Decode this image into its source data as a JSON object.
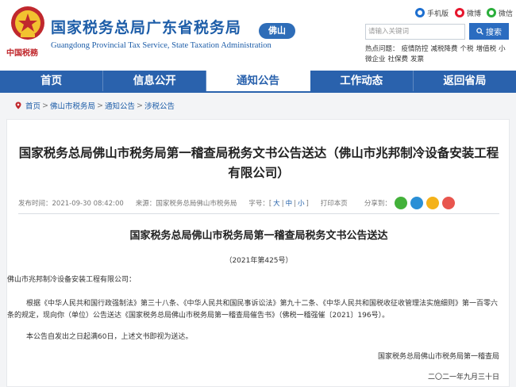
{
  "header": {
    "emblem_caption": "中国税務",
    "site_title": "国家税务总局广东省税务局",
    "site_subtitle": "Guangdong Provincial Tax Service, State Taxation Administration",
    "city_badge": "佛山",
    "social": [
      {
        "label": "手机版",
        "icon": "mobile-icon",
        "color": "#1d6fd0"
      },
      {
        "label": "微博",
        "icon": "weibo-icon",
        "color": "#e6162d"
      },
      {
        "label": "微信",
        "icon": "wechat-icon",
        "color": "#2aae3b"
      }
    ],
    "search": {
      "placeholder": "请输入关键词",
      "button": "搜索"
    },
    "hotwords_label": "热点问题：",
    "hotwords": [
      "疫情防控",
      "减税降费",
      "个税",
      "增值税",
      "小微企业",
      "社保费",
      "发票"
    ]
  },
  "nav": {
    "items": [
      "首页",
      "信息公开",
      "通知公告",
      "工作动态",
      "返回省局"
    ],
    "active_index": 2,
    "color": "#2a62ad"
  },
  "breadcrumb": {
    "items": [
      "首页",
      "佛山市税务局",
      "通知公告",
      "涉税公告"
    ],
    "separator": ">"
  },
  "article": {
    "title": "国家税务总局佛山市税务局第一稽查局税务文书公告送达（佛山市兆邦制冷设备安装工程有限公司）",
    "meta": {
      "date_label": "发布时间：",
      "date": "2021-09-30 08:42:00",
      "source_label": "来源：",
      "source": "国家税务总局佛山市税务局",
      "font_label": "字号：",
      "font_large": "大",
      "font_medium": "中",
      "font_small": "小",
      "print": "打印本页",
      "share_label": "分享到："
    },
    "share_icons": [
      "wechat-share-icon",
      "qq-share-icon",
      "qzone-share-icon",
      "weibo-share-icon"
    ],
    "doc_title": "国家税务总局佛山市税务局第一稽查局税务文书公告送达",
    "doc_no": "（2021年第425号）",
    "recipient": "佛山市兆邦制冷设备安装工程有限公司：",
    "body": "根据《中华人民共和国行政强制法》第三十八条、《中华人民共和国民事诉讼法》第九十二条、《中华人民共和国税收征收管理法实施细则》第一百零六条的规定，现向你（单位）公告送达《国家税务总局佛山市税务局第一稽查局催告书》（佛税一稽强催〔2021〕196号）。",
    "body2": "本公告自发出之日起满60日，上述文书即视为送达。",
    "signature": "国家税务总局佛山市税务局第一稽查局",
    "sign_date": "二〇二一年九月三十日"
  }
}
